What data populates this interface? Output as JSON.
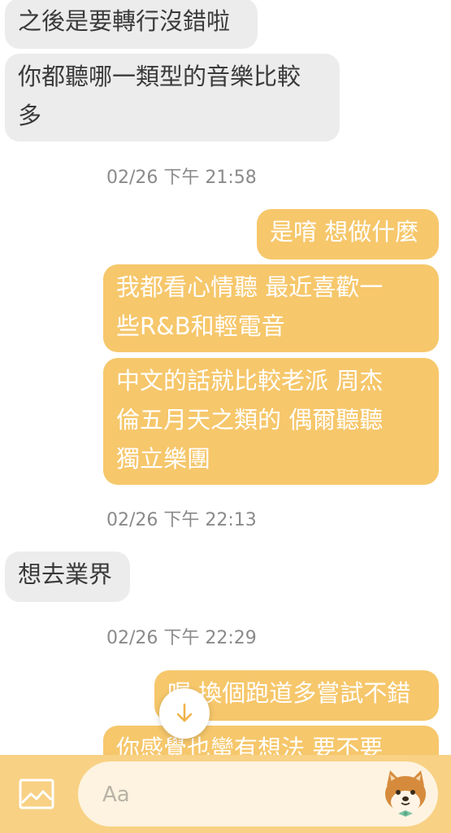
{
  "messages": [
    {
      "side": "in",
      "text": "之後是要轉行沒錯啦"
    },
    {
      "side": "in",
      "text": "你都聽哪一類型的音樂比較\n多"
    },
    {
      "side": "out",
      "text": "是唷 想做什麼"
    },
    {
      "side": "out",
      "text": "我都看心情聽 最近喜歡一\n些R&B和輕電音"
    },
    {
      "side": "out",
      "text": "中文的話就比較老派 周杰\n倫五月天之類的 偶爾聽聽\n獨立樂團"
    },
    {
      "side": "in",
      "text": "想去業界"
    },
    {
      "side": "out",
      "text": "喔 換個跑道多嘗試不錯"
    },
    {
      "side": "out",
      "text": "你感覺也蠻有想法 要不要"
    }
  ],
  "timestamps": [
    "02/26 下午 21:58",
    "02/26 下午 22:13",
    "02/26 下午 22:29"
  ],
  "composer": {
    "placeholder": "Aa",
    "image_icon": "image-icon",
    "sticker_icon": "shiba-sticker-icon"
  },
  "colors": {
    "outgoing_bubble": "#f6c76b",
    "incoming_bubble": "#ececec",
    "composer_bar": "#f8d184"
  },
  "scroll_button_icon": "arrow-down-icon"
}
